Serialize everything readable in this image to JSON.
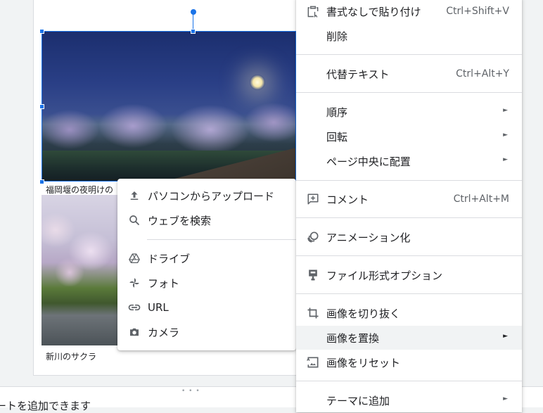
{
  "slide": {
    "caption1": "福岡堰の夜明けの",
    "caption2": "新川のサクラ"
  },
  "notes": {
    "text": "ートを追加できます"
  },
  "image_menu": {
    "items": [
      {
        "label": "パソコンからアップロード",
        "icon": "upload-icon"
      },
      {
        "label": "ウェブを検索",
        "icon": "search-icon"
      },
      {
        "label": "ドライブ",
        "icon": "drive-icon"
      },
      {
        "label": "フォト",
        "icon": "photos-icon"
      },
      {
        "label": "URL",
        "icon": "link-icon"
      },
      {
        "label": "カメラ",
        "icon": "camera-icon"
      }
    ]
  },
  "context_menu": {
    "paste_plain": {
      "label": "書式なしで貼り付け",
      "shortcut": "Ctrl+Shift+V"
    },
    "delete": {
      "label": "削除"
    },
    "alt_text": {
      "label": "代替テキスト",
      "shortcut": "Ctrl+Alt+Y"
    },
    "order": {
      "label": "順序"
    },
    "rotate": {
      "label": "回転"
    },
    "center": {
      "label": "ページ中央に配置"
    },
    "comment": {
      "label": "コメント",
      "shortcut": "Ctrl+Alt+M"
    },
    "animate": {
      "label": "アニメーション化"
    },
    "format_options": {
      "label": "ファイル形式オプション"
    },
    "crop": {
      "label": "画像を切り抜く"
    },
    "replace": {
      "label": "画像を置換"
    },
    "reset": {
      "label": "画像をリセット"
    },
    "add_theme": {
      "label": "テーマに追加"
    }
  },
  "colors": {
    "accent": "#1a73e8",
    "highlight": "#f1f3f4",
    "icon": "#5f6368"
  }
}
